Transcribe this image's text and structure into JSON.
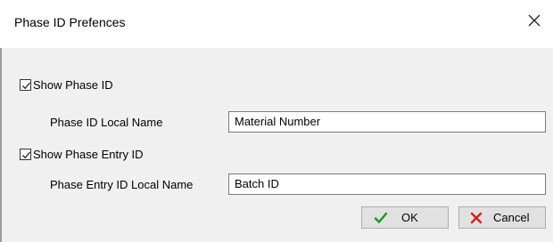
{
  "dialog": {
    "title": "Phase ID Prefences",
    "close_icon": "close-icon"
  },
  "show_phase_id": {
    "label": "Show Phase ID",
    "checked": true
  },
  "phase_id_local_name": {
    "label": "Phase ID Local Name",
    "value": "Material Number"
  },
  "show_phase_entry_id": {
    "label": "Show Phase Entry ID",
    "checked": true
  },
  "phase_entry_id_local_name": {
    "label": "Phase Entry ID Local Name",
    "value": "Batch ID"
  },
  "buttons": {
    "ok_label": "OK",
    "ok_icon": "checkmark-icon",
    "ok_icon_color": "#1a9a1a",
    "cancel_label": "Cancel",
    "cancel_icon": "x-icon",
    "cancel_icon_color": "#d32020"
  }
}
